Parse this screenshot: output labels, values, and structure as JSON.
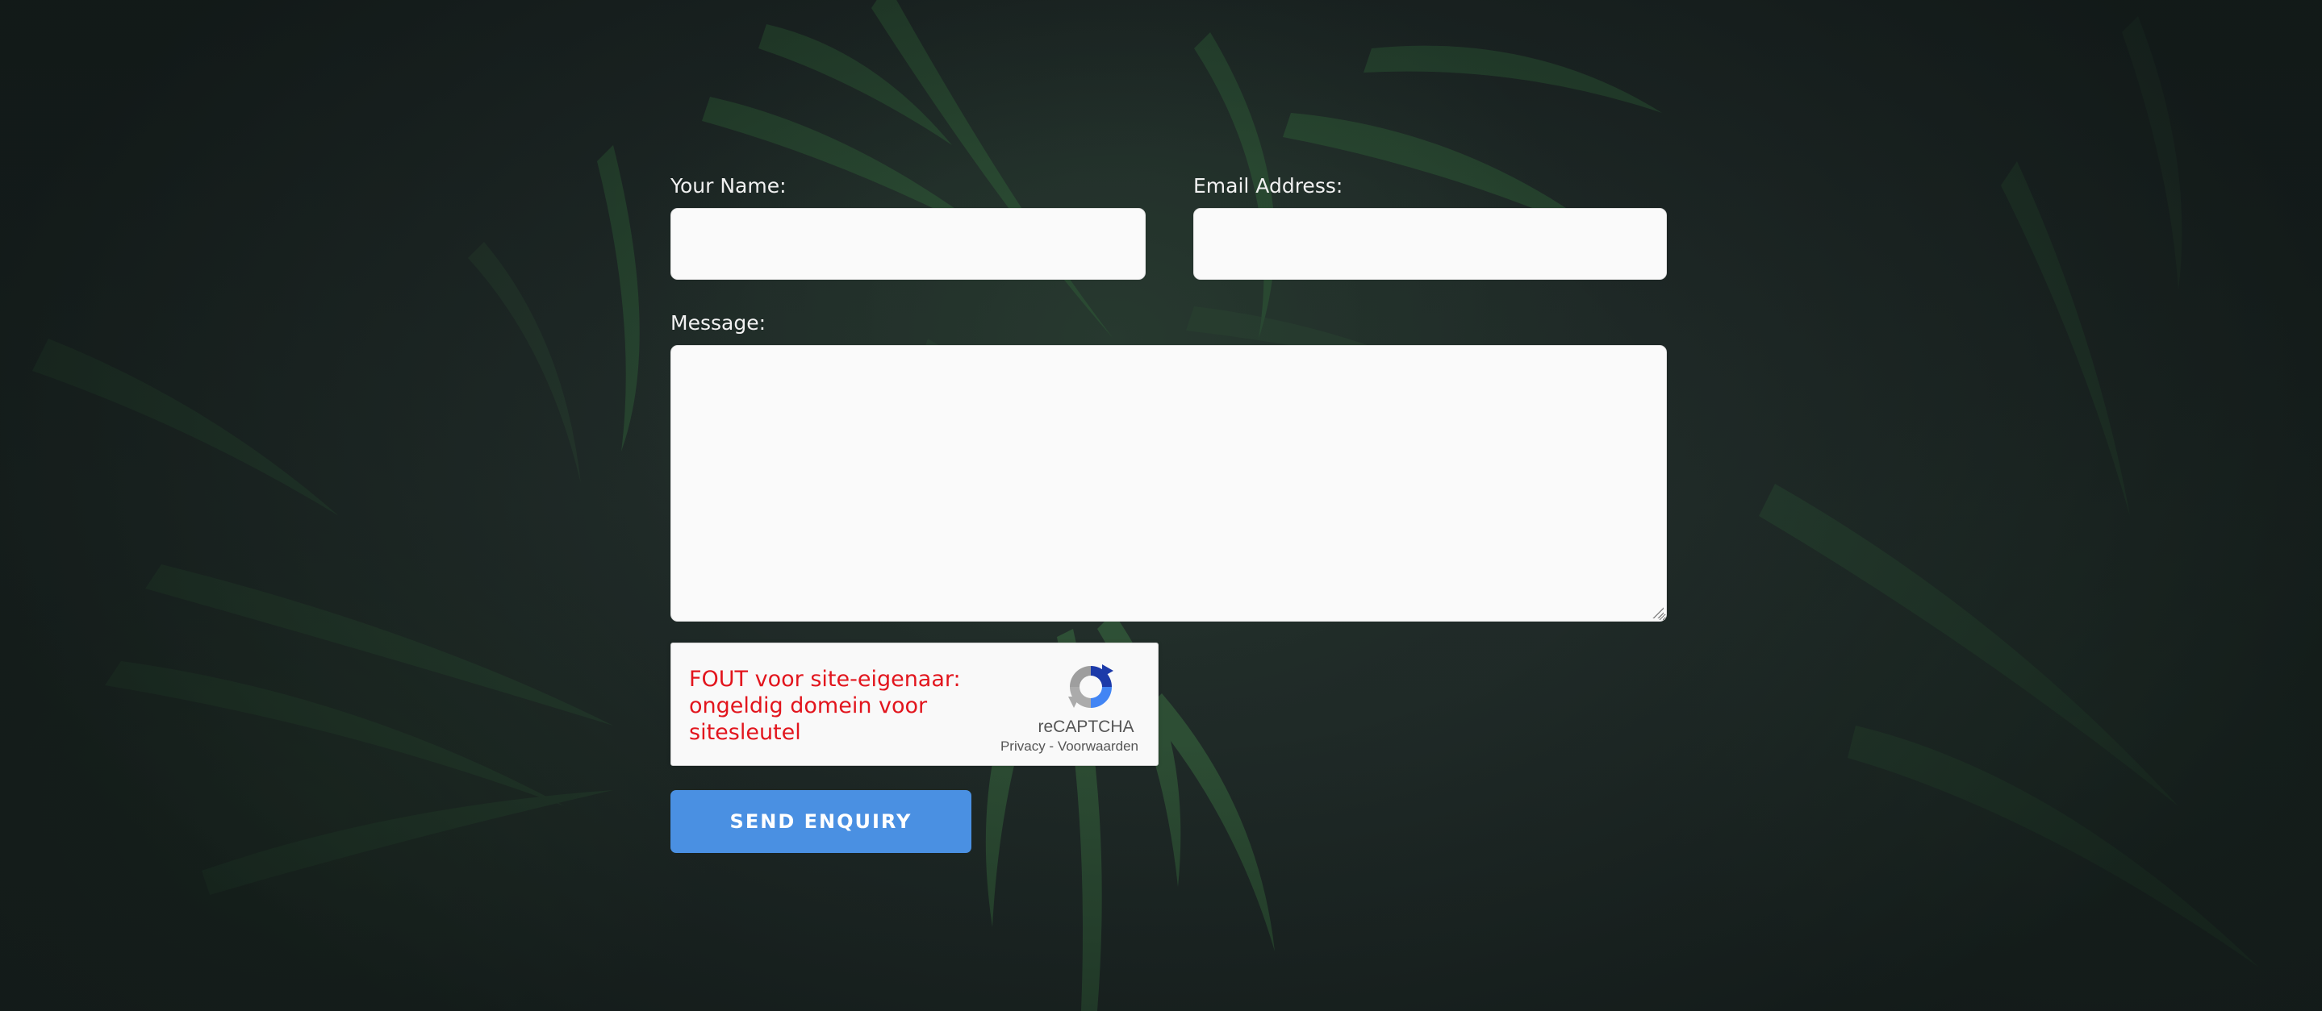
{
  "form": {
    "name_label": "Your Name:",
    "name_value": "",
    "email_label": "Email Address:",
    "email_value": "",
    "message_label": "Message:",
    "message_value": "",
    "submit_label": "SEND ENQUIRY"
  },
  "recaptcha": {
    "error_text": "FOUT voor site-eigenaar: ongeldig domein voor sitesleutel",
    "brand": "reCAPTCHA",
    "privacy_link": "Privacy",
    "separator": " - ",
    "terms_link": "Voorwaarden",
    "icon": "recaptcha-logo-icon"
  },
  "colors": {
    "submit_button": "#4a90e2",
    "error_text": "#e2151d",
    "label_text": "#f1f1f1",
    "background": "#1e2826"
  }
}
